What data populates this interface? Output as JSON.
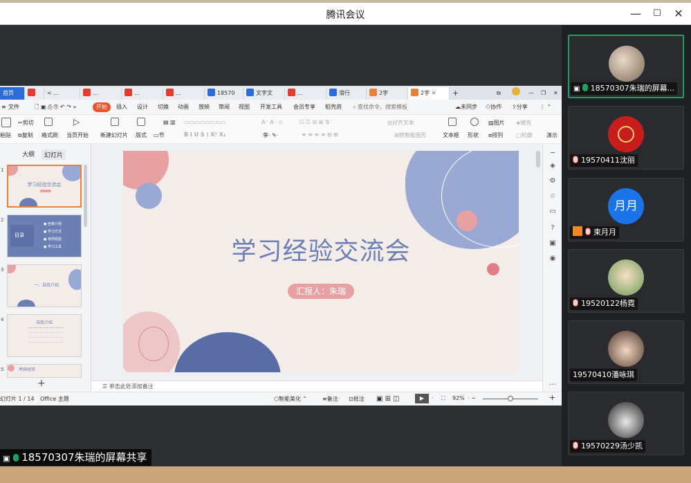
{
  "meeting": {
    "title": "腾讯会议",
    "share_banner": "18570307朱瑞的屏幕共享"
  },
  "wps": {
    "tabs": [
      {
        "label": "首页",
        "color": "#2b6cd8"
      },
      {
        "label": "",
        "color": "#e23b2e"
      },
      {
        "label": "< ...",
        "color": "#cfd4dc"
      },
      {
        "label": "...",
        "color": "#e23b2e"
      },
      {
        "label": "...",
        "color": "#e23b2e"
      },
      {
        "label": "...",
        "color": "#e23b2e"
      },
      {
        "label": "18570",
        "color": "#2b6cd8"
      },
      {
        "label": "文字文",
        "color": "#2b6cd8"
      },
      {
        "label": "...",
        "color": "#e23b2e"
      },
      {
        "label": "滑行",
        "color": "#2b6cd8"
      },
      {
        "label": "2字",
        "color": "#e8813b"
      },
      {
        "label": "2字",
        "color": "#e8813b"
      }
    ],
    "menus": [
      "文件",
      "开始",
      "插入",
      "设计",
      "切换",
      "动画",
      "放映",
      "审阅",
      "视图",
      "开发工具",
      "会员专享",
      "稻壳资"
    ],
    "active_menu": "开始",
    "search_placeholder": "查找命令、搜索模板",
    "right_menus": [
      "未同步",
      "协作",
      "分享"
    ],
    "ribbon": {
      "paste": "粘贴",
      "cut": "剪切",
      "copy": "复制",
      "format_painter": "格式刷",
      "from_current": "当页开始",
      "new_slide": "新建幻灯片",
      "layout": "版式",
      "section": "节",
      "align_text": "对齐文本",
      "convert_smartart": "转智能图形",
      "text_box": "文本框",
      "shape": "形状",
      "picture": "图片",
      "fill": "填充",
      "arrange": "排列",
      "outline": "轮廓",
      "rendering": "演示"
    },
    "panel_tabs": [
      "大纲",
      "幻灯片"
    ],
    "slides": {
      "s1_title": "学习经验交流会",
      "s2_title": "目录",
      "s2_items": [
        "自我介绍",
        "学习方法",
        "考研经验",
        "学习工具"
      ],
      "s3_title": "一、自我介绍",
      "s4_title": "自我介绍",
      "s5_title": "考研经验"
    },
    "slide": {
      "title": "学习经验交流会",
      "presenter": "汇报人：朱瑞"
    },
    "notes_placeholder": "单击此处添加备注",
    "status": {
      "page": "幻灯片 1 / 14",
      "theme": "Office 主题",
      "smart_beautify": "智能美化",
      "notes": "备注",
      "comments": "批注",
      "zoom": "92%"
    }
  },
  "participants": [
    {
      "name": "18570307朱瑞的屏幕...",
      "mic": "on",
      "active": true
    },
    {
      "name": "19570411沈丽",
      "mic": "off",
      "active": false
    },
    {
      "name": "束月月",
      "mic": "off",
      "active": false,
      "avatar_text": "月月"
    },
    {
      "name": "19520122杨霓",
      "mic": "off",
      "active": false
    },
    {
      "name": "19570410潘咏琪",
      "mic": "none",
      "active": false
    },
    {
      "name": "19570229汤少凯",
      "mic": "off",
      "active": false
    }
  ],
  "colors": {
    "accent_orange": "#e8532b",
    "slide_blue": "#6b7fb5",
    "slide_pink": "#e7a1a3",
    "mic_green": "#1aa260"
  }
}
